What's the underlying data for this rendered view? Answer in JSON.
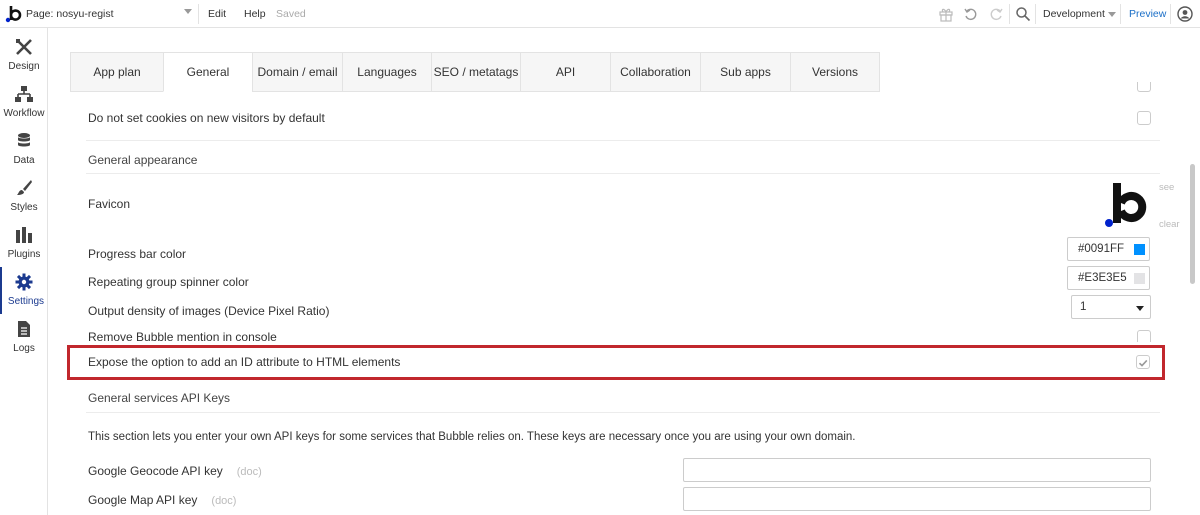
{
  "topbar": {
    "page_label": "Page: nosyu-regist",
    "menu": {
      "edit": "Edit",
      "help": "Help",
      "saved": "Saved"
    },
    "environment": "Development",
    "preview": "Preview"
  },
  "sidebar": {
    "items": [
      {
        "label": "Design",
        "icon": "design-icon"
      },
      {
        "label": "Workflow",
        "icon": "workflow-icon"
      },
      {
        "label": "Data",
        "icon": "database-icon"
      },
      {
        "label": "Styles",
        "icon": "brush-icon"
      },
      {
        "label": "Plugins",
        "icon": "plug-icon"
      },
      {
        "label": "Settings",
        "icon": "gear-icon",
        "active": true
      },
      {
        "label": "Logs",
        "icon": "document-icon"
      }
    ]
  },
  "tabs": [
    {
      "label": "App plan"
    },
    {
      "label": "General",
      "active": true
    },
    {
      "label": "Domain / email"
    },
    {
      "label": "Languages"
    },
    {
      "label": "SEO / metatags"
    },
    {
      "label": "API"
    },
    {
      "label": "Collaboration"
    },
    {
      "label": "Sub apps"
    },
    {
      "label": "Versions"
    }
  ],
  "settings": {
    "no_cookies": "Do not set cookies on new visitors by default",
    "general_appearance": "General appearance",
    "favicon": "Favicon",
    "favicon_see": "see",
    "favicon_clear": "clear",
    "progress_bar_color": {
      "label": "Progress bar color",
      "value": "#0091FF",
      "swatch": "#0091FF"
    },
    "spinner_color": {
      "label": "Repeating group spinner color",
      "value": "#E3E3E5",
      "swatch": "#E3E3E5"
    },
    "output_density": {
      "label": "Output density of images (Device Pixel Ratio)",
      "value": "1"
    },
    "remove_mention": "Remove Bubble mention in console",
    "expose_id": {
      "label": "Expose the option to add an ID attribute to HTML elements",
      "checked": true
    },
    "api_keys_title": "General services API Keys",
    "api_keys_desc": "This section lets you enter your own API keys for some services that Bubble relies on. These keys are necessary once you are using your own domain.",
    "geocode_key": {
      "label": "Google Geocode API key",
      "doc": "(doc)",
      "value": ""
    },
    "map_key": {
      "label": "Google Map API key",
      "doc": "(doc)",
      "value": ""
    }
  },
  "colors": {
    "accent": "#1b3a8f",
    "highlight": "#c1272d",
    "link": "#1b6fc7"
  }
}
